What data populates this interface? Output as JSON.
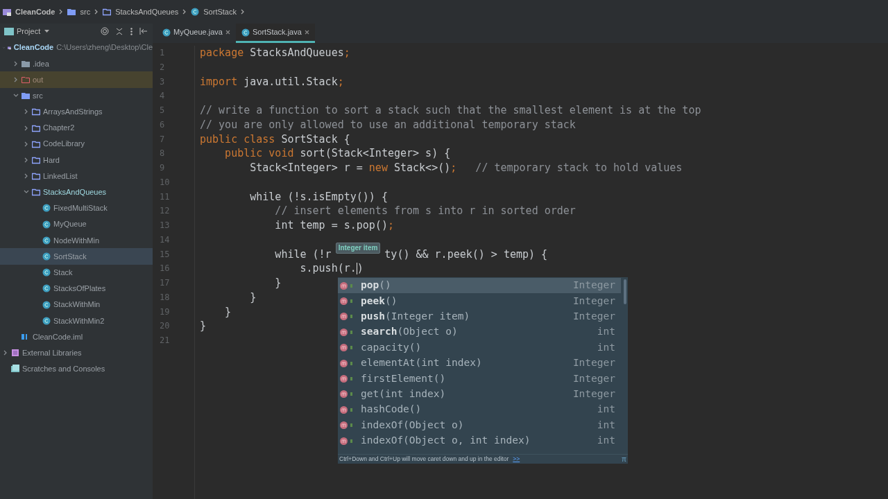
{
  "breadcrumbs": [
    {
      "label": "CleanCode",
      "kind": "module"
    },
    {
      "label": "src",
      "kind": "source"
    },
    {
      "label": "StacksAndQueues",
      "kind": "package"
    },
    {
      "label": "SortStack",
      "kind": "class"
    }
  ],
  "project_panel": {
    "title": "Project",
    "tree": [
      {
        "label": "CleanCode",
        "kind": "module",
        "path": "C:\\Users\\zheng\\Desktop\\Cle",
        "expanded": true,
        "selected": false,
        "children": [
          {
            "label": ".idea",
            "kind": "folder",
            "expanded": false,
            "selected": false
          },
          {
            "label": "out",
            "kind": "excluded",
            "expanded": false,
            "selected": false
          },
          {
            "label": "src",
            "kind": "source",
            "expanded": true,
            "selected": false,
            "children": [
              {
                "label": "ArraysAndStrings",
                "kind": "package",
                "expanded": false,
                "selected": false
              },
              {
                "label": "Chapter2",
                "kind": "package",
                "expanded": false,
                "selected": false
              },
              {
                "label": "CodeLibrary",
                "kind": "package",
                "expanded": false,
                "selected": false
              },
              {
                "label": "Hard",
                "kind": "package",
                "expanded": false,
                "selected": false
              },
              {
                "label": "LinkedList",
                "kind": "package",
                "expanded": false,
                "selected": false
              },
              {
                "label": "StacksAndQueues",
                "kind": "package",
                "expanded": true,
                "selected": false,
                "children": [
                  {
                    "label": "FixedMultiStack",
                    "kind": "class",
                    "selected": false
                  },
                  {
                    "label": "MyQueue",
                    "kind": "class",
                    "selected": false
                  },
                  {
                    "label": "NodeWithMin",
                    "kind": "class",
                    "selected": false
                  },
                  {
                    "label": "SortStack",
                    "kind": "class",
                    "selected": true
                  },
                  {
                    "label": "Stack",
                    "kind": "class",
                    "selected": false
                  },
                  {
                    "label": "StacksOfPlates",
                    "kind": "class",
                    "selected": false
                  },
                  {
                    "label": "StackWithMin",
                    "kind": "class",
                    "selected": false
                  },
                  {
                    "label": "StackWithMin2",
                    "kind": "class",
                    "selected": false
                  }
                ]
              }
            ]
          },
          {
            "label": "CleanCode.iml",
            "kind": "iml",
            "selected": false
          }
        ]
      },
      {
        "label": "External Libraries",
        "kind": "libraries",
        "expanded": false,
        "selected": false
      },
      {
        "label": "Scratches and Consoles",
        "kind": "scratches",
        "selected": false
      }
    ]
  },
  "tabs": [
    {
      "label": "MyQueue.java",
      "selected": false
    },
    {
      "label": "SortStack.java",
      "selected": true
    }
  ],
  "code_lines": [
    {
      "number": "1",
      "tokens": [
        {
          "text": "package ",
          "kind": "keyword"
        },
        {
          "text": "StacksAndQueues",
          "kind": "plain"
        },
        {
          "text": ";",
          "kind": "keyword"
        }
      ]
    },
    {
      "number": "2"
    },
    {
      "number": "3",
      "tokens": [
        {
          "text": "import ",
          "kind": "keyword"
        },
        {
          "text": "java.util.Stack",
          "kind": "plain"
        },
        {
          "text": ";",
          "kind": "keyword"
        }
      ]
    },
    {
      "number": "4"
    },
    {
      "number": "5",
      "tokens": [
        {
          "text": "// write a function to sort a stack such that the smallest element is at the top",
          "kind": "comment"
        }
      ]
    },
    {
      "number": "6",
      "tokens": [
        {
          "text": "// you are only allowed to use an additional temporary stack",
          "kind": "comment"
        }
      ]
    },
    {
      "number": "7",
      "tokens": [
        {
          "text": "public class ",
          "kind": "keyword"
        },
        {
          "text": "SortStack",
          "kind": "plain"
        },
        {
          "text": " {",
          "kind": "plain"
        }
      ]
    },
    {
      "number": "8",
      "tokens": [
        {
          "text": "    public void ",
          "kind": "keyword"
        },
        {
          "text": "sort",
          "kind": "plain"
        },
        {
          "text": "(Stack<Integer> s) {",
          "kind": "plain"
        }
      ]
    },
    {
      "number": "9",
      "tokens": [
        {
          "text": "        Stack<Integer> r = ",
          "kind": "plain"
        },
        {
          "text": "new ",
          "kind": "keyword"
        },
        {
          "text": "Stack<>()",
          "kind": "plain"
        },
        {
          "text": ";",
          "kind": "keyword"
        },
        {
          "text": "   // temporary stack to hold values",
          "kind": "comment"
        }
      ]
    },
    {
      "number": "10"
    },
    {
      "number": "11",
      "tokens": [
        {
          "text": "        while ",
          "kind": "plain"
        },
        {
          "text": "(!s.isEmpty()) {",
          "kind": "plain"
        }
      ]
    },
    {
      "number": "12",
      "tokens": [
        {
          "text": "            // insert elements from s into r in sorted order",
          "kind": "comment"
        }
      ]
    },
    {
      "number": "13",
      "tokens": [
        {
          "text": "            int ",
          "kind": "plain"
        },
        {
          "text": "temp = s.pop()",
          "kind": "plain"
        },
        {
          "text": ";",
          "kind": "keyword"
        }
      ]
    },
    {
      "number": "14"
    },
    {
      "number": "15",
      "tokens": [
        {
          "text": "            while (!r",
          "kind": "plain"
        },
        {
          "text": "Integer item",
          "kind": "tooltip"
        },
        {
          "text": "ty() && r.peek() > temp) {",
          "kind": "plain"
        }
      ]
    },
    {
      "number": "16",
      "tokens": [
        {
          "text": "                s.push(r.",
          "kind": "plain"
        },
        {
          "kind": "caret"
        },
        {
          "text": ")",
          "kind": "plain"
        }
      ]
    },
    {
      "number": "17",
      "tokens": [
        {
          "text": "            }",
          "kind": "plain"
        }
      ]
    },
    {
      "number": "18",
      "tokens": [
        {
          "text": "        }",
          "kind": "plain"
        }
      ]
    },
    {
      "number": "19",
      "tokens": [
        {
          "text": "    }",
          "kind": "plain"
        }
      ]
    },
    {
      "number": "20",
      "tokens": [
        {
          "text": "}",
          "kind": "plain"
        }
      ]
    },
    {
      "number": "21"
    }
  ],
  "completion": {
    "items": [
      {
        "name": "pop",
        "params": "()",
        "type": "Integer",
        "selected": true,
        "bold": true
      },
      {
        "name": "peek",
        "params": "()",
        "type": "Integer",
        "selected": false,
        "bold": true
      },
      {
        "name": "push",
        "params": "(Integer item)",
        "type": "Integer",
        "selected": false,
        "bold": true
      },
      {
        "name": "search",
        "params": "(Object o)",
        "type": "int",
        "selected": false,
        "bold": true
      },
      {
        "name": "capacity",
        "params": "()",
        "type": "int",
        "selected": false,
        "bold": false
      },
      {
        "name": "elementAt",
        "params": "(int index)",
        "type": "Integer",
        "selected": false,
        "bold": false
      },
      {
        "name": "firstElement",
        "params": "()",
        "type": "Integer",
        "selected": false,
        "bold": false
      },
      {
        "name": "get",
        "params": "(int index)",
        "type": "Integer",
        "selected": false,
        "bold": false
      },
      {
        "name": "hashCode",
        "params": "()",
        "type": "int",
        "selected": false,
        "bold": false
      },
      {
        "name": "indexOf",
        "params": "(Object o)",
        "type": "int",
        "selected": false,
        "bold": false
      },
      {
        "name": "indexOf",
        "params": "(Object o, int index)",
        "type": "int",
        "selected": false,
        "bold": false
      }
    ],
    "hint": "Ctrl+Down and Ctrl+Up will move caret down and up in the editor",
    "hint_link": ">>",
    "corner": "π"
  }
}
